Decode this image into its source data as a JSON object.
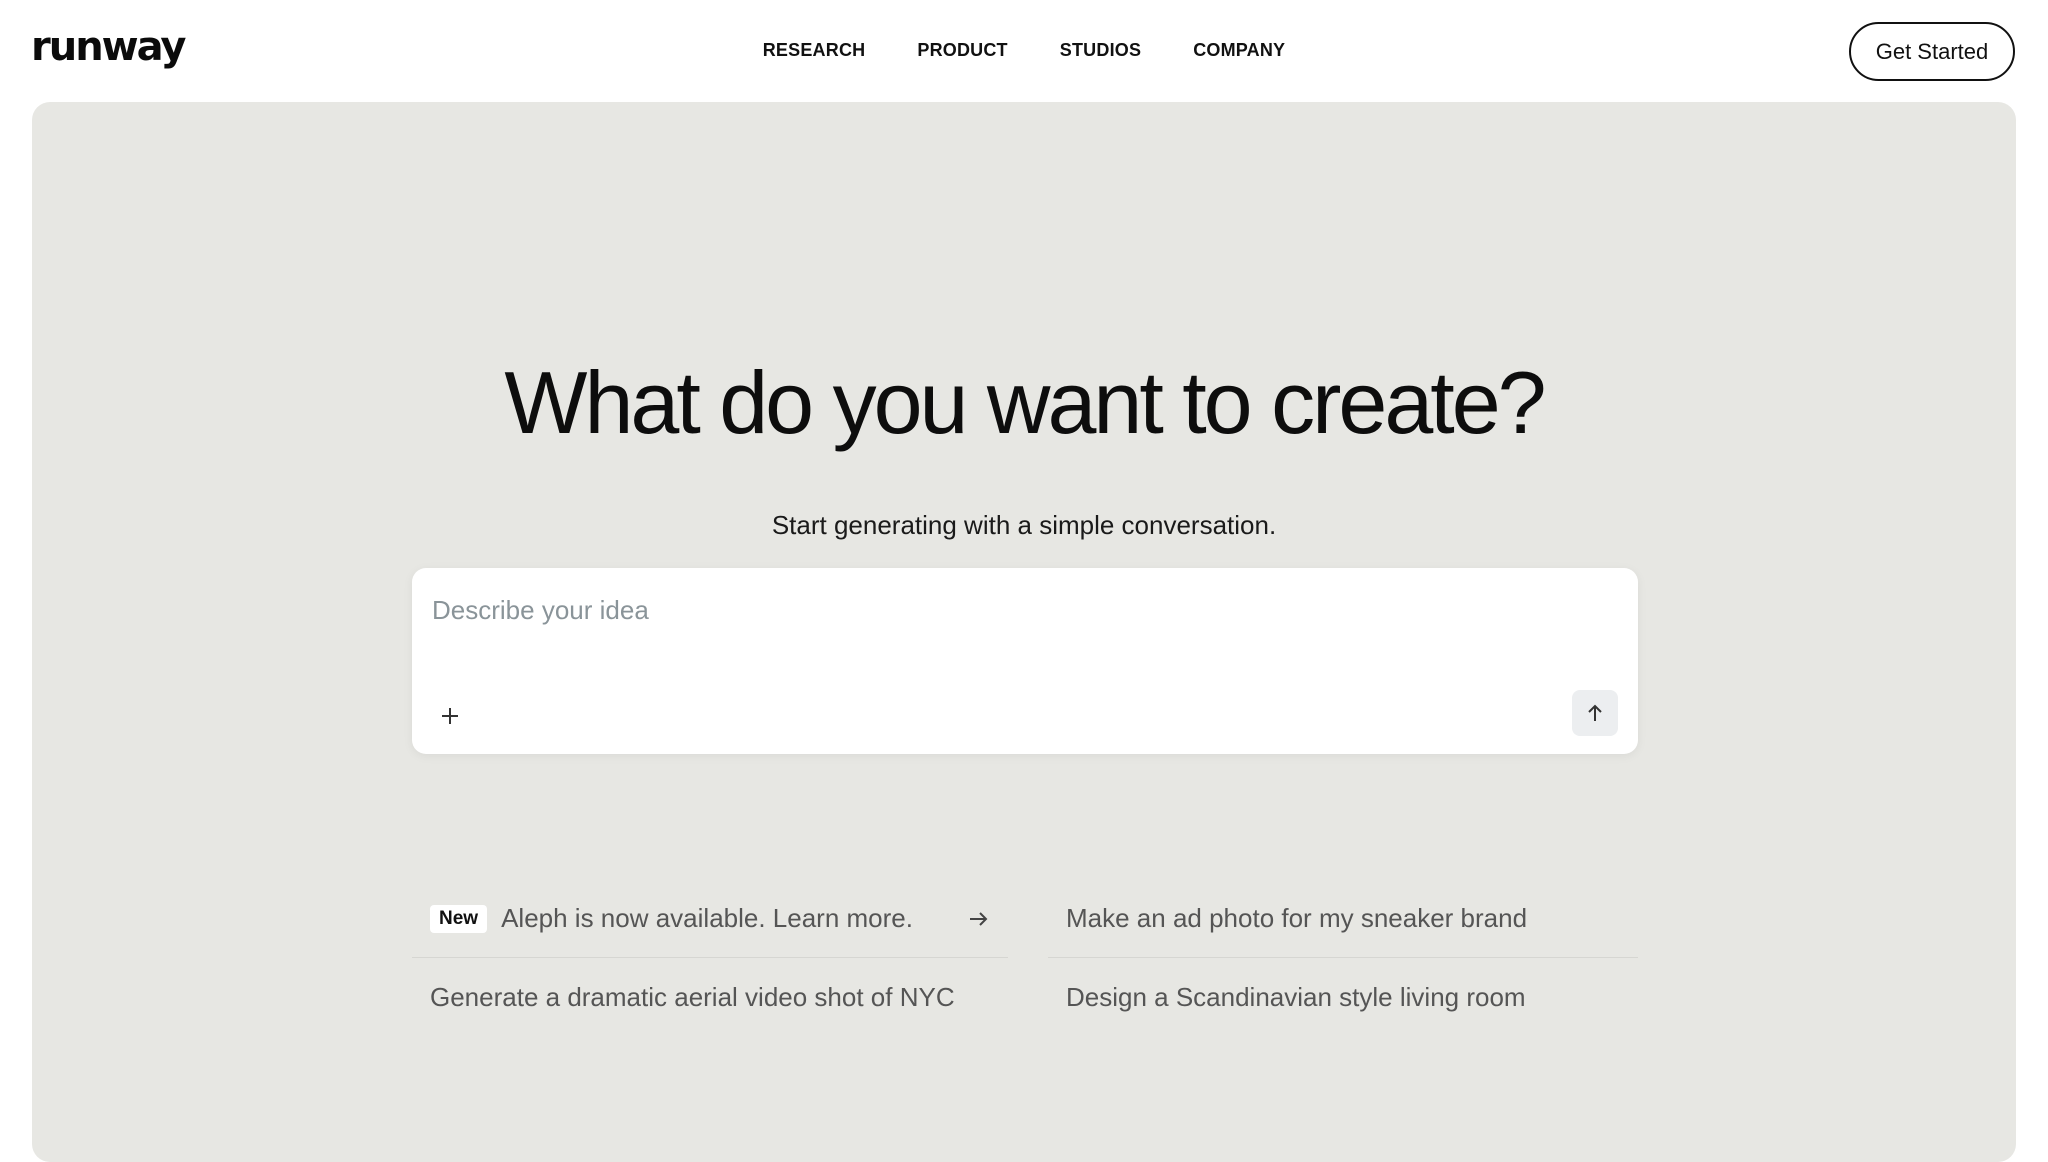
{
  "header": {
    "logo": "runway",
    "nav": [
      "RESEARCH",
      "PRODUCT",
      "STUDIOS",
      "COMPANY"
    ],
    "cta_label": "Get Started"
  },
  "hero": {
    "headline": "What do you want to create?",
    "subhead": "Start generating with a simple conversation.",
    "prompt_placeholder": "Describe your idea",
    "plus_icon": "plus-icon",
    "send_icon": "arrow-up-icon"
  },
  "suggestions": [
    {
      "badge": "New",
      "text": "Aleph is now available. Learn more.",
      "icon": "arrow-right-icon"
    },
    {
      "text": "Make an ad photo for my sneaker brand"
    },
    {
      "text": "Generate a dramatic aerial video shot of NYC"
    },
    {
      "text": "Design a Scandinavian style living room"
    }
  ]
}
